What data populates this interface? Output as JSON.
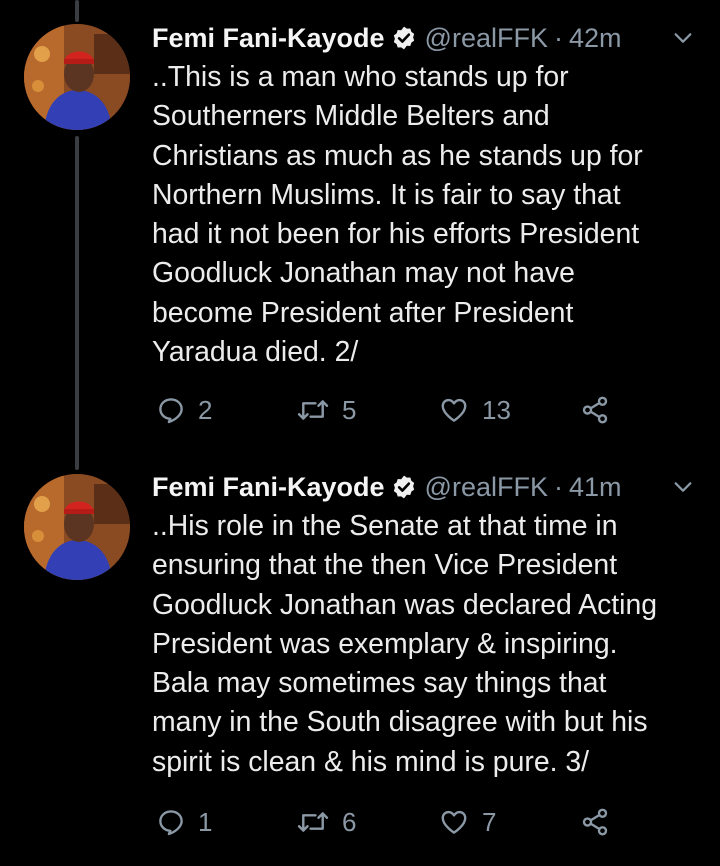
{
  "tweets": [
    {
      "name": "Femi Fani-Kayode",
      "handle": "@realFFK",
      "separator": "·",
      "time": "42m",
      "text": "..This is a man who stands up for\nSoutherners Middle Belters and\nChristians as much as he stands up for\nNorthern Muslims. It is fair to say that\nhad it not been for his efforts President\nGoodluck Jonathan may not have\nbecome President after President\nYaradua died. 2/",
      "replies": "2",
      "retweets": "5",
      "likes": "13"
    },
    {
      "name": "Femi Fani-Kayode",
      "handle": "@realFFK",
      "separator": "·",
      "time": "41m",
      "text": "..His role in the Senate at that time in\nensuring that the then Vice President\nGoodluck Jonathan was declared Acting\nPresident was exemplary & inspiring.\nBala may sometimes say things that\nmany in the South disagree with but his\nspirit is clean & his mind is pure. 3/",
      "replies": "1",
      "retweets": "6",
      "likes": "7"
    }
  ],
  "icons": {
    "reply": "reply-icon",
    "retweet": "retweet-icon",
    "like": "like-icon",
    "share": "share-icon",
    "verified": "verified-badge-icon",
    "more": "chevron-down-icon"
  },
  "colors": {
    "background": "#000000",
    "text": "#ececec",
    "muted": "#8b98a5",
    "thread_line": "#3a3d41"
  }
}
